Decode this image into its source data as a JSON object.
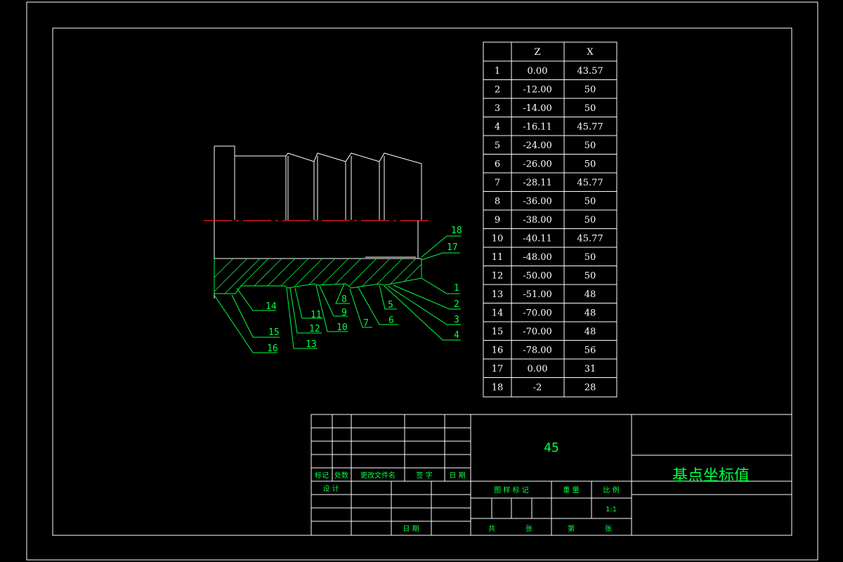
{
  "table": {
    "headers": [
      "",
      "Z",
      "X"
    ],
    "rows": [
      [
        "1",
        "0.00",
        "43.57"
      ],
      [
        "2",
        "-12.00",
        "50"
      ],
      [
        "3",
        "-14.00",
        "50"
      ],
      [
        "4",
        "-16.11",
        "45.77"
      ],
      [
        "5",
        "-24.00",
        "50"
      ],
      [
        "6",
        "-26.00",
        "50"
      ],
      [
        "7",
        "-28.11",
        "45.77"
      ],
      [
        "8",
        "-36.00",
        "50"
      ],
      [
        "9",
        "-38.00",
        "50"
      ],
      [
        "10",
        "-40.11",
        "45.77"
      ],
      [
        "11",
        "-48.00",
        "50"
      ],
      [
        "12",
        "-50.00",
        "50"
      ],
      [
        "13",
        "-51.00",
        "48"
      ],
      [
        "14",
        "-70.00",
        "48"
      ],
      [
        "15",
        "-70.00",
        "48"
      ],
      [
        "16",
        "-78.00",
        "56"
      ],
      [
        "17",
        "0.00",
        "31"
      ],
      [
        "18",
        "-2",
        "28"
      ]
    ]
  },
  "callouts": [
    "1",
    "2",
    "3",
    "4",
    "5",
    "6",
    "7",
    "8",
    "9",
    "10",
    "11",
    "12",
    "13",
    "14",
    "15",
    "16",
    "17",
    "18"
  ],
  "title_block": {
    "material": "45",
    "drawing_title": "基点坐标值",
    "mark": "标记",
    "count": "处数",
    "change_doc": "更改文件名",
    "signature": "签 字",
    "date": "日 期",
    "design": "设 计",
    "date2": "日 期",
    "stage_mark": "图 样 标 记",
    "weight": "重 量",
    "scale": "比 例",
    "scale_value": "1:1",
    "total": "共",
    "sheets": "张",
    "page": "第",
    "sheet": "张"
  },
  "colors": {
    "lines": "#ffffff",
    "annotation": "#00ff40",
    "centerline": "#ff2020",
    "background": "#000000"
  }
}
